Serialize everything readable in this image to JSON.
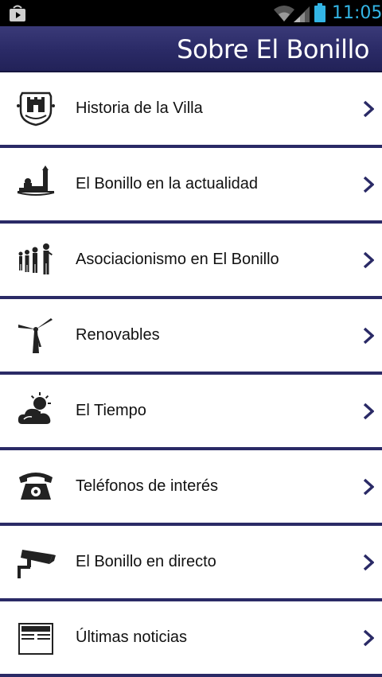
{
  "status_bar": {
    "time": "11:05",
    "icons": [
      "store-icon",
      "wifi-icon",
      "signal-icon",
      "battery-icon"
    ]
  },
  "header": {
    "title": "Sobre El Bonillo"
  },
  "menu": {
    "items": [
      {
        "label": "Historia de la Villa",
        "icon": "coat-of-arms-icon"
      },
      {
        "label": "El Bonillo en la actualidad",
        "icon": "town-skyline-icon"
      },
      {
        "label": "Asociacionismo en El Bonillo",
        "icon": "people-group-icon"
      },
      {
        "label": "Renovables",
        "icon": "wind-turbine-icon"
      },
      {
        "label": "El Tiempo",
        "icon": "weather-sun-cloud-icon"
      },
      {
        "label": "Teléfonos de interés",
        "icon": "telephone-icon"
      },
      {
        "label": "El Bonillo en directo",
        "icon": "camera-icon"
      },
      {
        "label": "Últimas noticias",
        "icon": "newspaper-icon"
      }
    ]
  },
  "colors": {
    "header_bg": "#2a2a66",
    "divider": "#2a2a66",
    "chevron": "#2a2a66",
    "clock": "#33b5e5"
  }
}
